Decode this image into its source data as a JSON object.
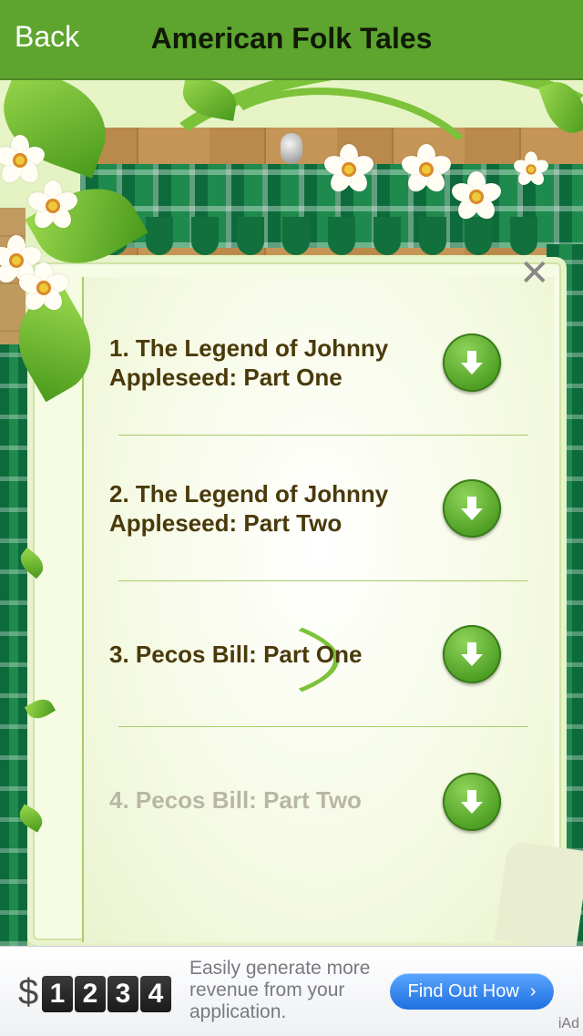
{
  "navbar": {
    "back_label": "Back",
    "title": "American Folk Tales"
  },
  "stories": [
    {
      "line1": "1.   The Legend of Johnny",
      "line2": "Appleseed: Part One",
      "dimmed": false
    },
    {
      "line1": "2.   The Legend of Johnny",
      "line2": "Appleseed: Part Two",
      "dimmed": false
    },
    {
      "line1": "3.   Pecos Bill: Part One",
      "line2": "",
      "dimmed": false
    },
    {
      "line1": "4.   Pecos Bill: Part Two",
      "line2": "",
      "dimmed": true
    }
  ],
  "ad": {
    "dollar": "$",
    "digits": [
      "1",
      "2",
      "3",
      "4"
    ],
    "text": "Easily generate more revenue from your application.",
    "cta": "Find Out How",
    "cta_icon": "chevron-right-icon",
    "brand": "iAd"
  },
  "colors": {
    "navbar": "#5ea530",
    "button_green": "#4f9f25",
    "title_brown": "#4a3a0a",
    "cta_blue": "#1f6fe0"
  }
}
